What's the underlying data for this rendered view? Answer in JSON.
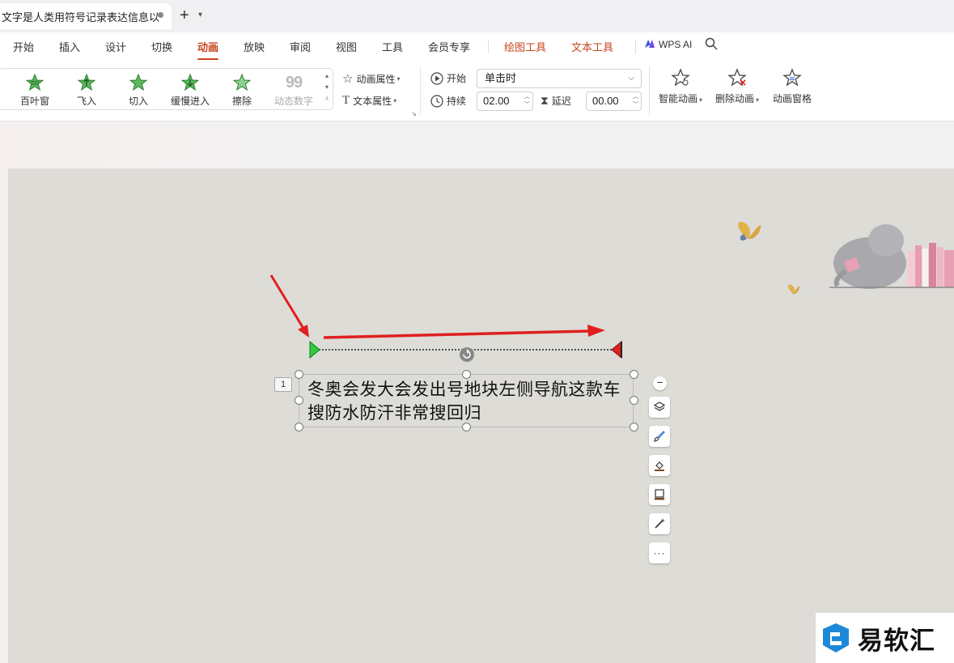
{
  "tab": {
    "title": "文字是人类用符号记录表达信息以"
  },
  "menu": {
    "items": [
      "开始",
      "插入",
      "设计",
      "切换",
      "动画",
      "放映",
      "审阅",
      "视图",
      "工具",
      "会员专享"
    ],
    "active": "动画",
    "tools": [
      "绘图工具",
      "文本工具"
    ],
    "wps_ai": "WPS AI"
  },
  "ribbon": {
    "effects": [
      "百叶窗",
      "飞入",
      "切入",
      "缓慢进入",
      "擦除",
      "动态数字"
    ],
    "anim_props": "动画属性",
    "text_props": "文本属性",
    "start_label": "开始",
    "start_value": "单击时",
    "duration_label": "持续",
    "duration_value": "02.00",
    "delay_label": "延迟",
    "delay_value": "00.00",
    "smart_anim": "智能动画",
    "delete_anim": "删除动画",
    "anim_pane": "动画窗格"
  },
  "slide": {
    "text": "冬奥会发大会发出号地块左侧导航这款车搜防水防汗非常搜回归",
    "anim_number": "1"
  },
  "watermark": {
    "text": "易软汇"
  },
  "colors": {
    "accent": "#c7461e",
    "star_green": "#4caf50",
    "arrow_red": "#e02020"
  }
}
